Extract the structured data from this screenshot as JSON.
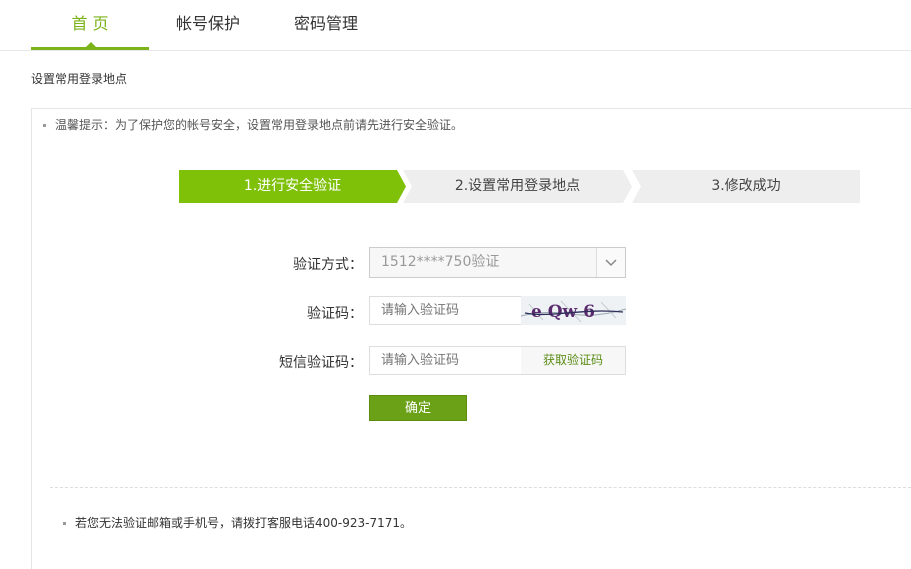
{
  "tabs": [
    {
      "label": "首 页",
      "active": true
    },
    {
      "label": "帐号保护",
      "active": false
    },
    {
      "label": "密码管理",
      "active": false
    }
  ],
  "page_subtitle": "设置常用登录地点",
  "tip": "温馨提示：为了保护您的帐号安全，设置常用登录地点前请先进行安全验证。",
  "steps": [
    {
      "label": "1.进行安全验证",
      "active": true
    },
    {
      "label": "2.设置常用登录地点",
      "active": false
    },
    {
      "label": "3.修改成功",
      "active": false
    }
  ],
  "form": {
    "method_label": "验证方式：",
    "method_value": "1512****750验证",
    "captcha_label": "验证码：",
    "captcha_placeholder": "请输入验证码",
    "captcha_text": "e Qw 6",
    "sms_label": "短信验证码：",
    "sms_placeholder": "请输入验证码",
    "get_code_label": "获取验证码",
    "confirm_label": "确定"
  },
  "footer_note": "若您无法验证邮箱或手机号，请拨打客服电话400-923-7171。",
  "colors": {
    "accent": "#7bb31a",
    "step_active": "#7fc009",
    "step_inactive": "#eeeeee",
    "button": "#6aa116"
  }
}
